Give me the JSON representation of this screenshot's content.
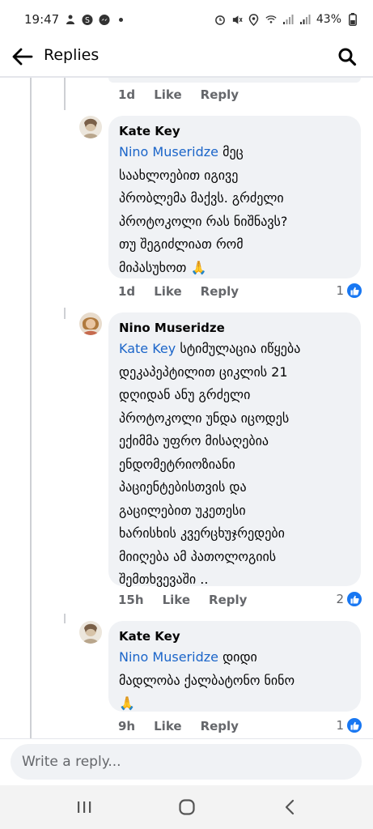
{
  "status_bar": {
    "time": "19:47",
    "battery": "43%"
  },
  "header": {
    "title": "Replies"
  },
  "previous_comment": {
    "time": "1d",
    "like_label": "Like",
    "reply_label": "Reply"
  },
  "comments": [
    {
      "author": "Kate Key",
      "mention": "Nino Museridze",
      "lines": [
        "მეც",
        "საახლოებით იგივე",
        "პრობლემა მაქვს. გრძელი",
        "პროტოკოლი რას ნიშნავს?",
        "თუ შეგიძლიათ რომ",
        "მიპასუხოთ 🙏"
      ],
      "time": "1d",
      "like_label": "Like",
      "reply_label": "Reply",
      "likes": "1"
    },
    {
      "author": "Nino Museridze",
      "mention": "Kate Key",
      "lines": [
        "სტიმულაცია იწყება",
        "დეკაპეპტილით ციკლის 21",
        "დღიდან ანუ გრძელი",
        "პროტოკოლი უნდა იცოდეს",
        "ექიმმა უფრო მისაღებია",
        "ენდომეტრიოზიანი",
        "პაციენტებისთვის და",
        "გაცილებით უკეთესი",
        "ხარისხის კვერცხუჯრედები",
        "მიიღება ამ პათოლოგიის",
        "შემთხვევაში .."
      ],
      "time": "15h",
      "like_label": "Like",
      "reply_label": "Reply",
      "likes": "2"
    },
    {
      "author": "Kate Key",
      "mention": "Nino Museridze",
      "lines": [
        "დიდი",
        "მადლობა ქალბატონო ნინო",
        "🙏"
      ],
      "time": "9h",
      "like_label": "Like",
      "reply_label": "Reply",
      "likes": "1"
    }
  ],
  "composer": {
    "placeholder": "Write a reply..."
  },
  "colors": {
    "mention": "#1b65c9",
    "bubble": "#f0f2f5",
    "meta": "#65676b",
    "like_badge": "#1877f2"
  }
}
